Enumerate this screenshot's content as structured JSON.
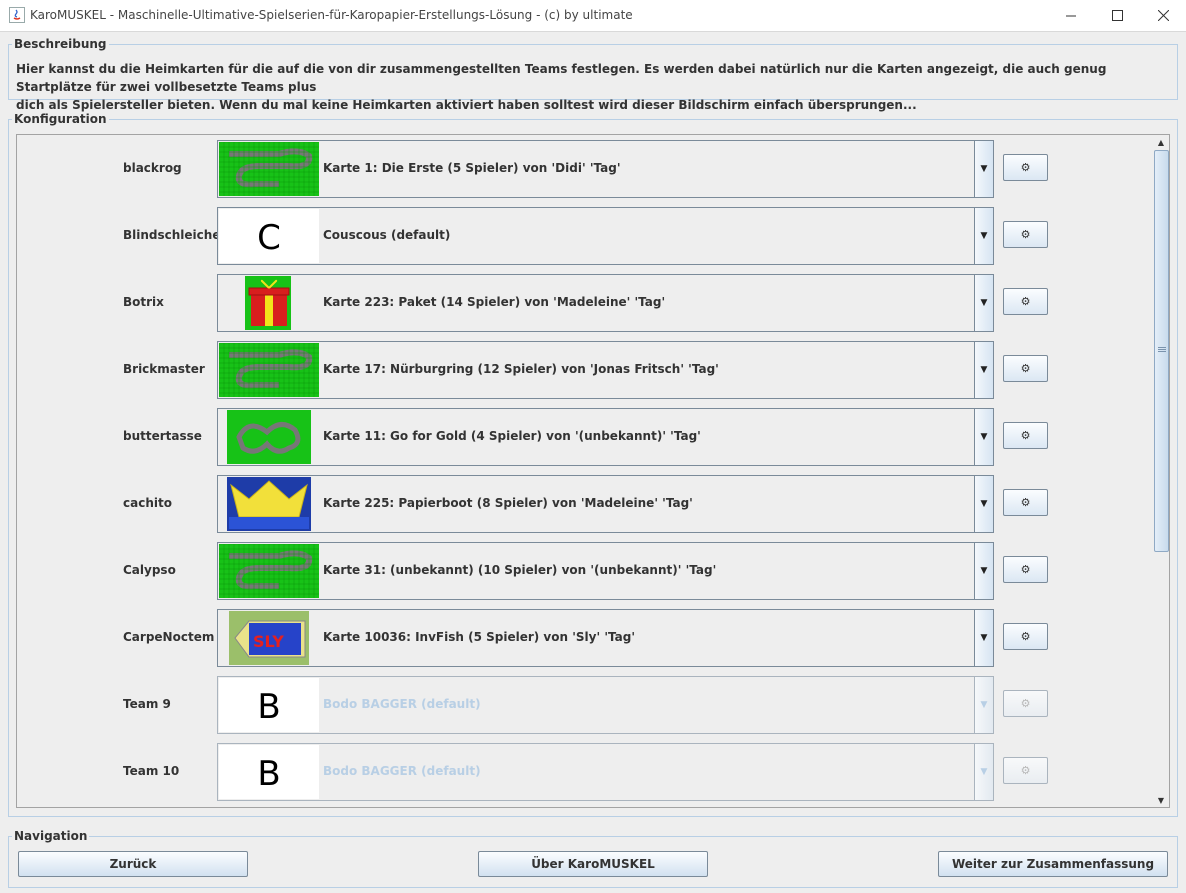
{
  "window": {
    "title": "KaroMUSKEL - Maschinelle-Ultimative-Spielserien-für-Karopapier-Erstellungs-Lösung - (c) by ultimate"
  },
  "beschreibung": {
    "legend": "Beschreibung",
    "line1": "Hier kannst du die Heimkarten für die auf die von dir zusammengestellten Teams festlegen. Es werden dabei natürlich nur die Karten angezeigt, die auch genug Startplätze für zwei vollbesetzte Teams plus",
    "line2": "dich als Spielersteller bieten. Wenn du mal keine Heimkarten aktiviert haben solltest wird dieser Bildschirm einfach übersprungen..."
  },
  "konfiguration": {
    "legend": "Konfiguration",
    "gear_label": "⚙",
    "rows": [
      {
        "team": "blackrog",
        "map": "Karte 1: Die Erste (5 Spieler) von 'Didi' 'Tag'",
        "thumb": "track-green",
        "enabled": true
      },
      {
        "team": "Blindschleiche",
        "map": "Couscous (default)",
        "thumb": "letter",
        "letter": "C",
        "enabled": true
      },
      {
        "team": "Botrix",
        "map": "Karte 223: Paket (14 Spieler) von 'Madeleine' 'Tag'",
        "thumb": "gift",
        "enabled": true
      },
      {
        "team": "Brickmaster",
        "map": "Karte 17: Nürburgring (12 Spieler) von 'Jonas Fritsch' 'Tag'",
        "thumb": "track-green",
        "enabled": true
      },
      {
        "team": "buttertasse",
        "map": "Karte 11: Go for Gold (4 Spieler) von '(unbekannt)' 'Tag'",
        "thumb": "track-green-small",
        "enabled": true
      },
      {
        "team": "cachito",
        "map": "Karte 225: Papierboot (8 Spieler) von 'Madeleine' 'Tag'",
        "thumb": "boat",
        "enabled": true
      },
      {
        "team": "Calypso",
        "map": "Karte 31: (unbekannt) (10 Spieler) von '(unbekannt)' 'Tag'",
        "thumb": "track-green",
        "enabled": true
      },
      {
        "team": "CarpeNoctem",
        "map": "Karte 10036: InvFish (5 Spieler) von 'Sly' 'Tag'",
        "thumb": "fish",
        "enabled": true
      },
      {
        "team": "Team 9",
        "map": "Bodo BAGGER (default)",
        "thumb": "letter",
        "letter": "B",
        "enabled": false
      },
      {
        "team": "Team 10",
        "map": "Bodo BAGGER (default)",
        "thumb": "letter",
        "letter": "B",
        "enabled": false
      }
    ]
  },
  "navigation": {
    "legend": "Navigation",
    "back": "Zurück",
    "about": "Über KaroMUSKEL",
    "next": "Weiter zur Zusammenfassung"
  }
}
